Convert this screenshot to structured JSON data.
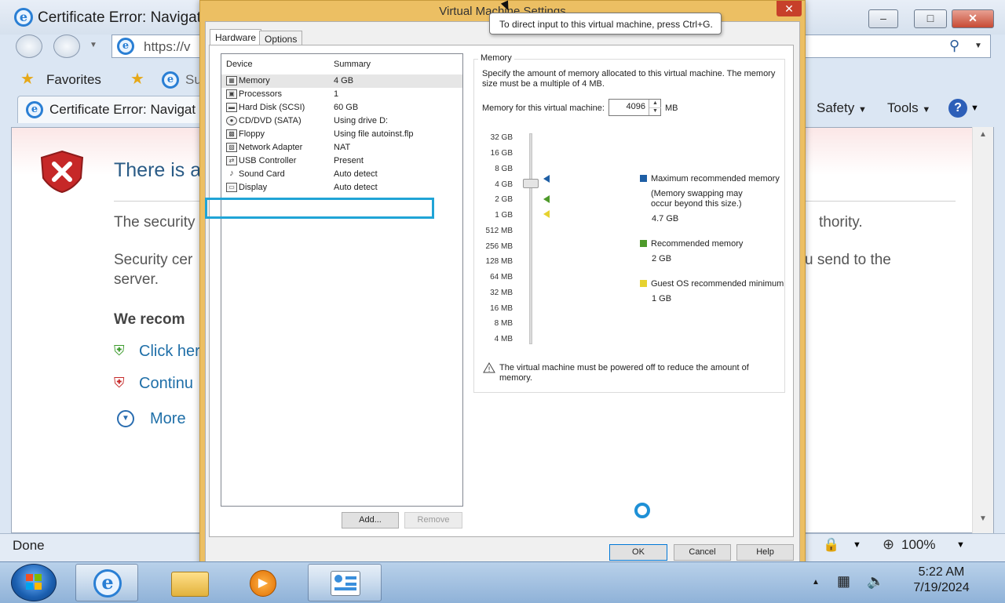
{
  "ie": {
    "window_title": "Certificate Error: Navigat",
    "address": "https://v",
    "favorites_label": "Favorites",
    "fav_link": "Su",
    "tab_title": "Certificate Error: Navigat",
    "commands": {
      "safety": "Safety",
      "tools": "Tools"
    },
    "heading": "There is a",
    "paragraph1": "The security",
    "paragraph1_right": "thority.",
    "paragraph2_line1": "Security cer",
    "paragraph2_right": "u send to the",
    "paragraph2_line2": "server.",
    "recommend": "We recom",
    "link_close": "Click her",
    "link_continue": "Continu",
    "more_info": "More",
    "status": "Done",
    "zoom": "100%"
  },
  "dialog": {
    "title": "Virtual Machine Settings",
    "tooltip": "To direct input to this virtual machine, press Ctrl+G.",
    "tabs": [
      "Hardware",
      "Options"
    ],
    "device_header": "Device",
    "summary_header": "Summary",
    "devices": [
      {
        "name": "Memory",
        "summary": "4 GB",
        "icon": "memory-icon"
      },
      {
        "name": "Processors",
        "summary": "1",
        "icon": "processor-icon"
      },
      {
        "name": "Hard Disk (SCSI)",
        "summary": "60 GB",
        "icon": "harddisk-icon"
      },
      {
        "name": "CD/DVD (SATA)",
        "summary": "Using drive D:",
        "icon": "cd-icon"
      },
      {
        "name": "Floppy",
        "summary": "Using file autoinst.flp",
        "icon": "floppy-icon"
      },
      {
        "name": "Network Adapter",
        "summary": "NAT",
        "icon": "network-icon"
      },
      {
        "name": "USB Controller",
        "summary": "Present",
        "icon": "usb-icon"
      },
      {
        "name": "Sound Card",
        "summary": "Auto detect",
        "icon": "sound-icon"
      },
      {
        "name": "Display",
        "summary": "Auto detect",
        "icon": "display-icon"
      }
    ],
    "add_button": "Add...",
    "remove_button": "Remove",
    "memory": {
      "group_title": "Memory",
      "description": "Specify the amount of memory allocated to this virtual machine. The memory size must be a multiple of 4 MB.",
      "field_label": "Memory for this virtual machine:",
      "value": "4096",
      "unit": "MB",
      "ticks": [
        "32 GB",
        "16 GB",
        "8 GB",
        "4 GB",
        "2 GB",
        "1 GB",
        "512 MB",
        "256 MB",
        "128 MB",
        "64 MB",
        "32 MB",
        "16 MB",
        "8 MB",
        "4 MB"
      ],
      "legend": {
        "max_label": "Maximum recommended memory",
        "max_note": "(Memory swapping may occur beyond this size.)",
        "max_value": "4.7 GB",
        "rec_label": "Recommended memory",
        "rec_value": "2 GB",
        "min_label": "Guest OS recommended minimum",
        "min_value": "1 GB"
      },
      "warning": "The virtual machine must be powered off to reduce the amount of memory."
    },
    "ok": "OK",
    "cancel": "Cancel",
    "help": "Help"
  },
  "taskbar": {
    "time": "5:22 AM",
    "date": "7/19/2024"
  },
  "colors": {
    "dialog_frame": "#ecbf63",
    "max_marker": "#1f5fa5",
    "rec_marker": "#4e9a2a",
    "min_marker": "#e6d230",
    "highlight": "#20a4d6"
  }
}
